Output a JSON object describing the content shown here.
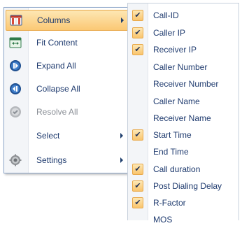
{
  "menu": {
    "items": [
      {
        "label": "Columns",
        "icon": "columns-icon",
        "submenu": true,
        "highlight": true,
        "disabled": false
      },
      {
        "label": "Fit Content",
        "icon": "fit-content-icon",
        "submenu": false,
        "disabled": false
      },
      {
        "label": "Expand All",
        "icon": "expand-all-icon",
        "submenu": false,
        "disabled": false
      },
      {
        "label": "Collapse All",
        "icon": "collapse-all-icon",
        "submenu": false,
        "disabled": false
      },
      {
        "label": "Resolve All",
        "icon": "resolve-all-icon",
        "submenu": false,
        "disabled": true
      },
      {
        "label": "Select",
        "icon": "",
        "submenu": true,
        "disabled": false
      },
      {
        "label": "Settings",
        "icon": "settings-icon",
        "submenu": true,
        "disabled": false
      }
    ]
  },
  "columns_submenu": {
    "items": [
      {
        "label": "Call-ID",
        "checked": true
      },
      {
        "label": "Caller IP",
        "checked": true
      },
      {
        "label": "Receiver IP",
        "checked": true
      },
      {
        "label": "Caller Number",
        "checked": false
      },
      {
        "label": "Receiver Number",
        "checked": false
      },
      {
        "label": "Caller Name",
        "checked": false
      },
      {
        "label": "Receiver Name",
        "checked": false
      },
      {
        "label": "Start Time",
        "checked": true
      },
      {
        "label": "End Time",
        "checked": false
      },
      {
        "label": "Call duration",
        "checked": true
      },
      {
        "label": "Post Dialing Delay",
        "checked": true
      },
      {
        "label": "R-Factor",
        "checked": true
      },
      {
        "label": "MOS",
        "checked": false
      }
    ]
  },
  "colors": {
    "text": "#1e3a6e",
    "highlight": "#fbc874",
    "check_bg": "#fde0a0",
    "disabled": "#8a8f96"
  }
}
